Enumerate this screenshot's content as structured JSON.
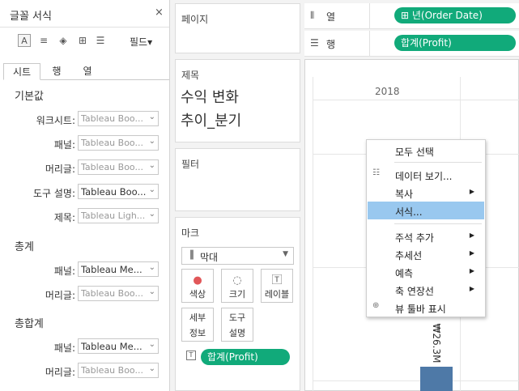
{
  "format_pane": {
    "title": "글꼴 서식",
    "close": "×",
    "field_dropdown": "필드▾",
    "tabs": [
      "시트",
      "행",
      "열"
    ],
    "sections": {
      "default": {
        "title": "기본값",
        "rows": [
          {
            "label": "워크시트:",
            "value": "Tableau Boo..."
          },
          {
            "label": "패널:",
            "value": "Tableau Boo..."
          },
          {
            "label": "머리글:",
            "value": "Tableau Boo..."
          },
          {
            "label": "도구 설명:",
            "value": "Tableau Boo..."
          },
          {
            "label": "제목:",
            "value": "Tableau Ligh..."
          }
        ]
      },
      "total": {
        "title": "총계",
        "rows": [
          {
            "label": "패널:",
            "value": "Tableau Me..."
          },
          {
            "label": "머리글:",
            "value": "Tableau Boo..."
          }
        ]
      },
      "grand_total": {
        "title": "총합계",
        "rows": [
          {
            "label": "패널:",
            "value": "Tableau Me..."
          },
          {
            "label": "머리글:",
            "value": "Tableau Boo..."
          }
        ]
      }
    }
  },
  "pages": {
    "label": "페이지"
  },
  "title_card": {
    "label": "제목",
    "line1": "수익 변화",
    "line2": "추이_분기"
  },
  "filters": {
    "label": "필터"
  },
  "marks": {
    "label": "마크",
    "type": "막대",
    "buttons": {
      "color": "색상",
      "size": "크기",
      "label": "레이블",
      "detail": "세부\n정보",
      "tooltip": "도구\n설명"
    },
    "pill": "합계(Profit)"
  },
  "shelves": {
    "columns": {
      "label": "열",
      "pill": "⊞ 년(Order Date)"
    },
    "rows": {
      "label": "행",
      "pill": "합계(Profit)"
    }
  },
  "view": {
    "year_header": "2018",
    "bar_label": "₩26.3M"
  },
  "context_menu": {
    "items": [
      {
        "label": "모두 선택"
      },
      {
        "label": "데이터 보기..."
      },
      {
        "label": "복사"
      },
      {
        "label": "서식..."
      },
      {
        "label": "주석 추가"
      },
      {
        "label": "추세선"
      },
      {
        "label": "예측"
      },
      {
        "label": "축 연장선"
      },
      {
        "label": "뷰 툴바 표시"
      }
    ]
  },
  "colors": {
    "accent": "#11aa7a",
    "bar": "#4e79a7",
    "highlight": "#99c8ef"
  }
}
